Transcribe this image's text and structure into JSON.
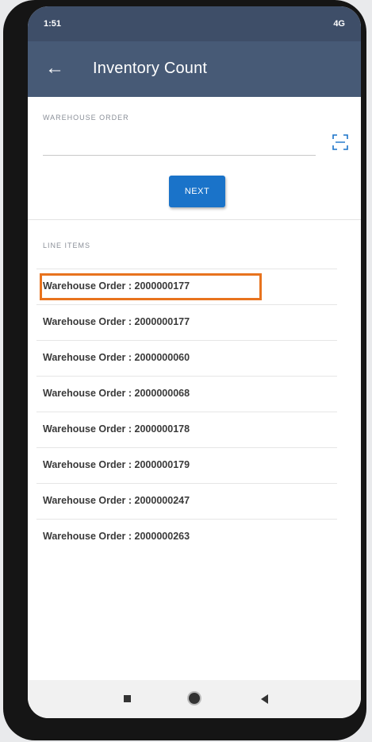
{
  "status_bar": {
    "time": "1:51",
    "icons": "4G"
  },
  "app_bar": {
    "back_icon": "arrow-left-icon",
    "title": "Inventory Count"
  },
  "form": {
    "warehouse_order_label": "WAREHOUSE ORDER",
    "warehouse_order_value": "",
    "scan_icon": "barcode-scan-icon",
    "next_label": "NEXT"
  },
  "line_items": {
    "section_label": "LINE ITEMS",
    "items": [
      {
        "label": "Warehouse Order : 2000000177"
      },
      {
        "label": "Warehouse Order : 2000000177"
      },
      {
        "label": "Warehouse Order : 2000000060"
      },
      {
        "label": "Warehouse Order : 2000000068"
      },
      {
        "label": "Warehouse Order : 2000000178"
      },
      {
        "label": "Warehouse Order : 2000000179"
      },
      {
        "label": "Warehouse Order : 2000000247"
      },
      {
        "label": "Warehouse Order : 2000000263"
      }
    ]
  },
  "colors": {
    "app_bar": "#475a76",
    "status_bar": "#3e4e68",
    "primary_button": "#1a73c9",
    "highlight": "#e8731e"
  }
}
